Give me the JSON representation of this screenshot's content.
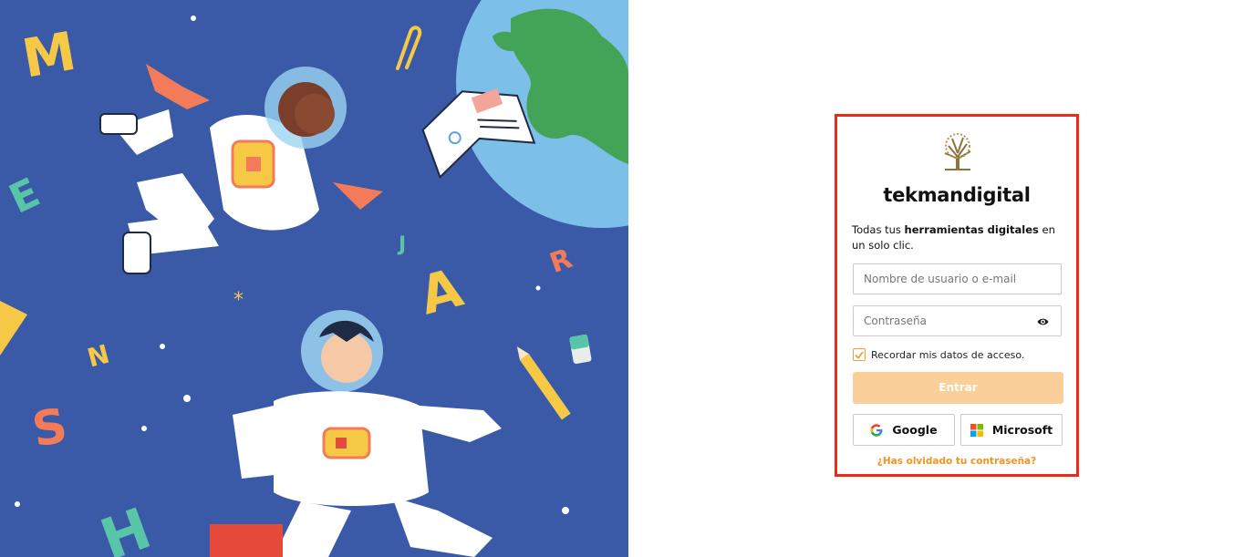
{
  "colors": {
    "illustration_background": "#3a5aa8",
    "card_border": "#ee2a17",
    "submit_background": "#fbcf99",
    "accent_orange": "#f3931f"
  },
  "illustration": {
    "letters": [
      "M",
      "E",
      "J",
      "R",
      "A",
      "N",
      "S",
      "H"
    ],
    "icons": [
      "astronaut-girl-icon",
      "astronaut-boy-icon",
      "earth-icon",
      "book-icon",
      "paperclip-icon",
      "pencil-icon",
      "ruler-icon",
      "eraser-icon",
      "star-icon"
    ]
  },
  "login": {
    "logo_icon": "tree-logo-icon",
    "brand": "tekmandigital",
    "tagline_before": "Todas tus ",
    "tagline_bold": "herramientas digitales",
    "tagline_after": " en un solo clic.",
    "username_placeholder": "Nombre de usuario o e-mail",
    "password_placeholder": "Contraseña",
    "password_toggle_icon": "eye-icon",
    "remember_checked": true,
    "remember_label": "Recordar mis datos de acceso.",
    "submit_label": "Entrar",
    "google_label": "Google",
    "microsoft_label": "Microsoft",
    "forgot_label": "¿Has olvidado tu contraseña?"
  }
}
